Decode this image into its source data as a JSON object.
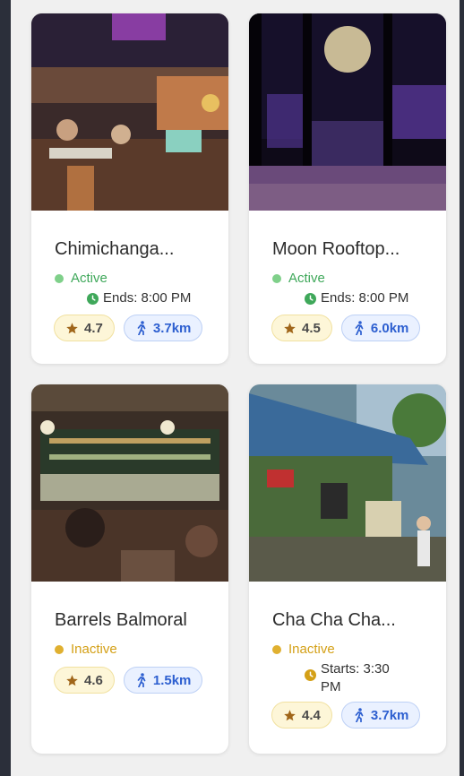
{
  "venues": [
    {
      "name": "Chimichanga...",
      "status": "Active",
      "time_label": "Ends: 8:00 PM",
      "rating": "4.7",
      "distance": "3.7km",
      "photo": "restaurant-interior-photo"
    },
    {
      "name": "Moon Rooftop...",
      "status": "Active",
      "time_label": "Ends: 8:00 PM",
      "rating": "4.5",
      "distance": "6.0km",
      "photo": "rooftop-bar-night-photo"
    },
    {
      "name": "Barrels Balmoral",
      "status": "Inactive",
      "time_label": "",
      "rating": "4.6",
      "distance": "1.5km",
      "photo": "bar-counter-photo"
    },
    {
      "name": "Cha Cha Cha...",
      "status": "Inactive",
      "time_label_line1": "Starts: 3:30",
      "time_label_line2": "PM",
      "rating": "4.4",
      "distance": "3.7km",
      "photo": "street-cafe-photo"
    }
  ],
  "colors": {
    "active": "#3fa85a",
    "inactive": "#d4a017",
    "rating_bg": "#fdf6d8",
    "distance_bg": "#eaf1ff",
    "distance_text": "#2d5fd0"
  },
  "icons": {
    "rating": "star-icon",
    "distance": "walking-person-icon",
    "time": "clock-icon"
  }
}
